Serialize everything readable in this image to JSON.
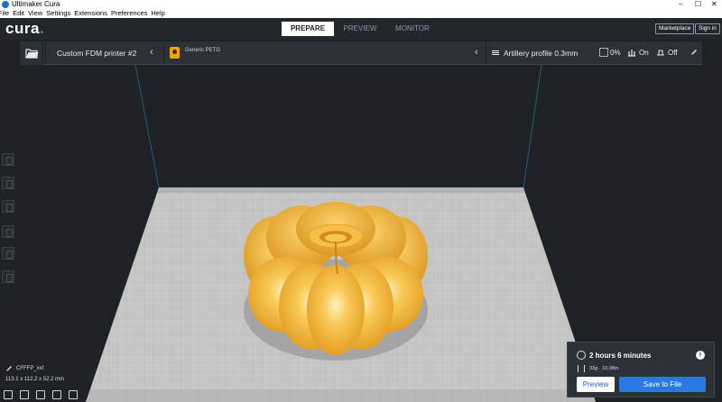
{
  "window": {
    "title": "Ultimaker Cura",
    "controls": [
      "–",
      "☐",
      "✕"
    ]
  },
  "menu": [
    "File",
    "Edit",
    "View",
    "Settings",
    "Extensions",
    "Preferences",
    "Help"
  ],
  "header": {
    "logo_main": "cura",
    "logo_dot": ".",
    "tabs": [
      "PREPARE",
      "PREVIEW",
      "MONITOR"
    ],
    "active_tab": "PREPARE",
    "marketplace": "Marketplace",
    "signin": "Sign in"
  },
  "toolbar": {
    "printer_name": "Custom FDM printer #2",
    "material_name": "Generic PETG",
    "profile_name": "Artillery profile 0.3mm",
    "infill": "0%",
    "support": "On",
    "adhesion": "Off"
  },
  "object": {
    "filename": "CFFFP_xxf",
    "dimensions": "113.1 x 112.2 x 52.2 mm"
  },
  "estimate": {
    "time": "2 hours 6 minutes",
    "material": "33g · 10.08m",
    "preview_label": "Preview",
    "save_label": "Save to File"
  },
  "colors": {
    "accent": "#2b78e4",
    "model": "#f7b23b",
    "material_badge": "#f3a200",
    "bed": "#c4c4c4",
    "background": "#1e2226"
  },
  "icons": [
    "open-folder-icon",
    "chevron-left-icon",
    "material-icon",
    "profile-icon",
    "infill-icon",
    "support-icon",
    "adhesion-icon",
    "edit-icon",
    "clock-icon",
    "info-icon",
    "filament-icon"
  ]
}
